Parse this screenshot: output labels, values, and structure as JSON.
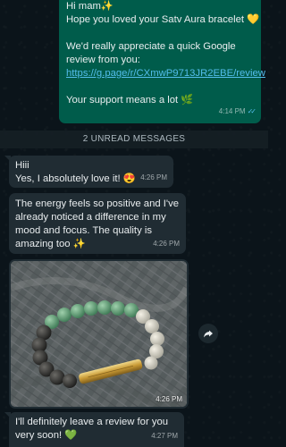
{
  "messages": {
    "outgoing": {
      "lines": [
        "Hi mam✨",
        "Hope you loved your Satv Aura bracelet 💛",
        "We'd really appreciate a quick Google",
        "review from you:",
        "https://g.page/r/CXmwP9713JR2EBE/review",
        "Your support means a lot 🌿"
      ],
      "time": "4:14 PM"
    },
    "unread_divider": "2 UNREAD MESSAGES",
    "incoming": [
      {
        "lines": [
          "Hiii",
          "Yes, I absolutely love it! 😍"
        ],
        "time": "4:26 PM"
      },
      {
        "lines": [
          "The energy feels so positive and I've",
          "already noticed a difference in my",
          "mood and focus. The quality is",
          "amazing too ✨"
        ],
        "time": "4:26 PM"
      },
      {
        "photo_time": "4:26 PM"
      },
      {
        "lines": [
          "I'll definitely leave a review for you",
          "very soon! 💚"
        ],
        "time": "4:27 PM"
      }
    ]
  },
  "colors": {
    "background": "#0b141a",
    "outgoing_bubble": "#005c4b",
    "incoming_bubble": "#202c33",
    "link": "#53bdeb",
    "read_ticks": "#53bdeb"
  },
  "icons": {
    "share": "forward-arrow-icon",
    "read_status": "double-check-icon"
  }
}
